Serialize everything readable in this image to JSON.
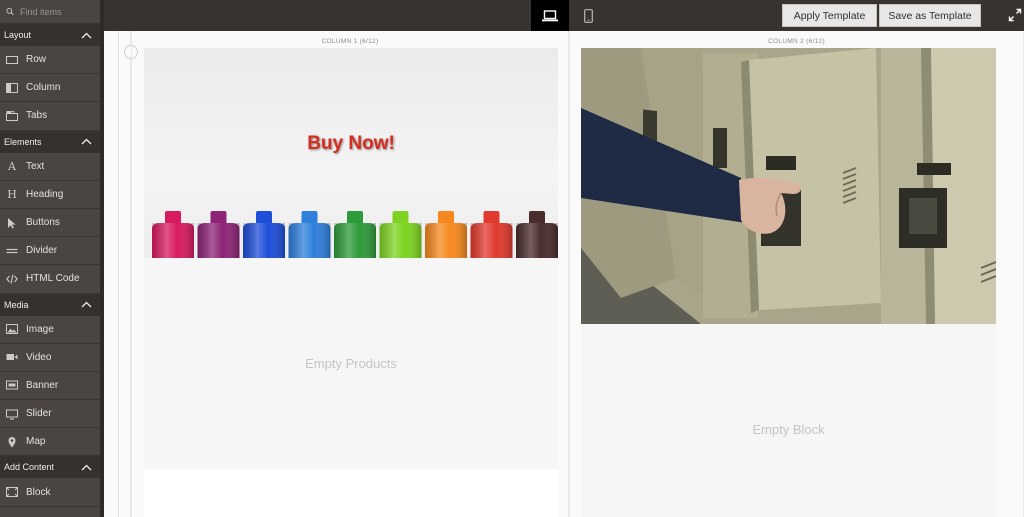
{
  "sidebar": {
    "search_placeholder": "Find items",
    "groups": [
      {
        "title": "Layout",
        "items": [
          {
            "label": "Row",
            "icon": "row-icon"
          },
          {
            "label": "Column",
            "icon": "column-icon"
          },
          {
            "label": "Tabs",
            "icon": "tabs-icon"
          }
        ]
      },
      {
        "title": "Elements",
        "items": [
          {
            "label": "Text",
            "icon": "text-icon"
          },
          {
            "label": "Heading",
            "icon": "heading-icon"
          },
          {
            "label": "Buttons",
            "icon": "cursor-icon"
          },
          {
            "label": "Divider",
            "icon": "divider-icon"
          },
          {
            "label": "HTML Code",
            "icon": "code-icon"
          }
        ]
      },
      {
        "title": "Media",
        "items": [
          {
            "label": "Image",
            "icon": "image-icon"
          },
          {
            "label": "Video",
            "icon": "video-icon"
          },
          {
            "label": "Banner",
            "icon": "banner-icon"
          },
          {
            "label": "Slider",
            "icon": "slider-icon"
          },
          {
            "label": "Map",
            "icon": "map-pin-icon"
          }
        ]
      },
      {
        "title": "Add Content",
        "items": [
          {
            "label": "Block",
            "icon": "block-icon"
          }
        ]
      }
    ]
  },
  "toolbar": {
    "apply_label": "Apply Template",
    "save_label": "Save as Template"
  },
  "stage": {
    "column1_label": "COLUMN 1 (6/12)",
    "column2_label": "COLUMN 2 (6/12)",
    "banner_text": "Buy Now!",
    "empty_products": "Empty Products",
    "empty_block": "Empty Block"
  },
  "colors": {
    "sidebar_bg": "#4a4542",
    "group_bg": "#35312f",
    "topbar_bg": "#373330",
    "banner_text": "#d62d20"
  },
  "bottles": [
    "#d81b60",
    "#8e2477",
    "#1e4ed8",
    "#2f7fdc",
    "#2e9b3a",
    "#7ed321",
    "#f5891f",
    "#e03a2e",
    "#4a2c2c"
  ]
}
